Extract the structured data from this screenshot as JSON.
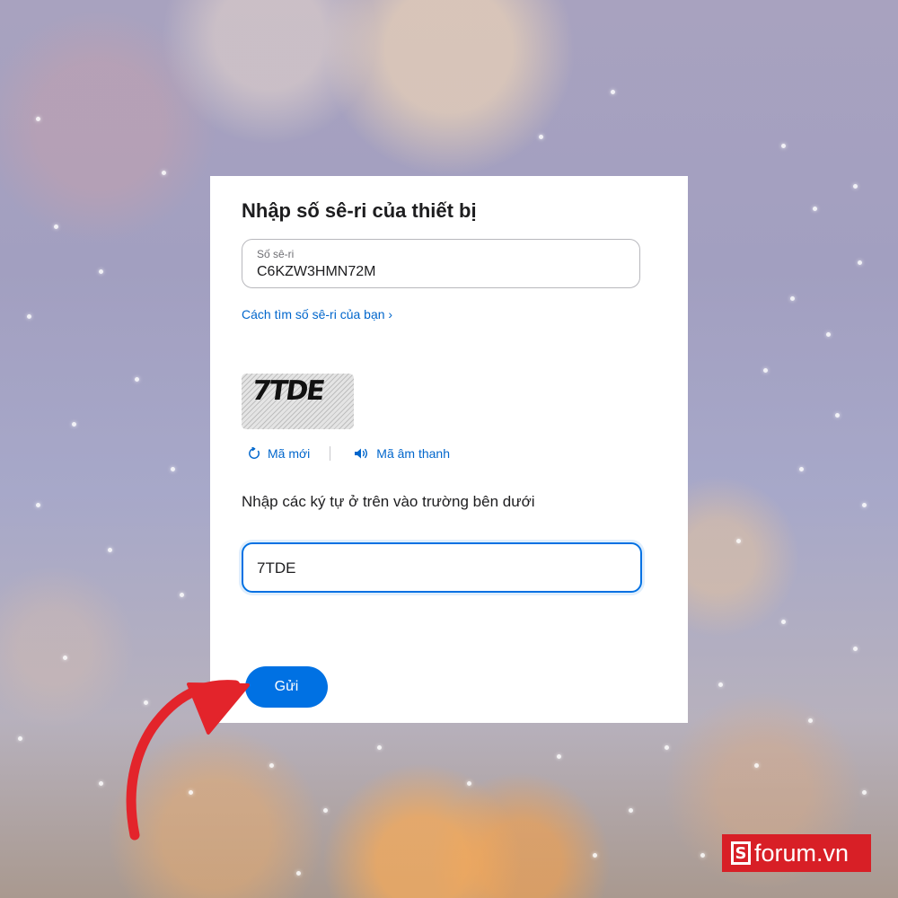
{
  "form": {
    "title": "Nhập số sê-ri của thiết bị",
    "serial_label": "Số sê-ri",
    "serial_value": "C6KZW3HMN72M",
    "help_link": "Cách tìm số sê-ri của bạn ›",
    "captcha_text": "7TDE",
    "new_code_label": "Mã mới",
    "audio_code_label": "Mã âm thanh",
    "instruction": "Nhập các ký tự ở trên vào trường bên dưới",
    "captcha_input_value": "7TDE",
    "submit_label": "Gửi"
  },
  "icons": {
    "refresh": "refresh-icon",
    "speaker": "speaker-icon",
    "annotation": "arrow-icon"
  },
  "watermark": {
    "mark": "S",
    "text": "forum.vn"
  },
  "colors": {
    "accent": "#0071e3",
    "link": "#0066cc",
    "annotation_arrow": "#e3242b",
    "logo_bg": "#d81f26"
  }
}
